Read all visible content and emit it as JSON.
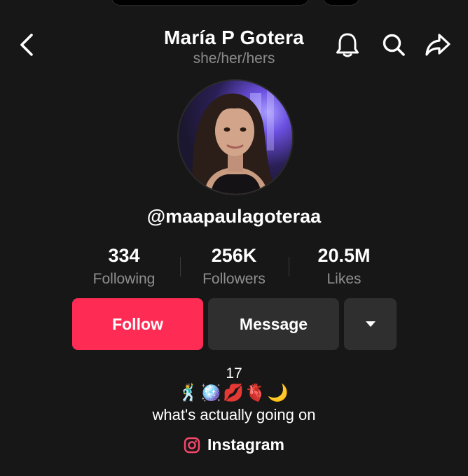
{
  "header": {
    "title": "María P Gotera",
    "pronouns": "she/her/hers",
    "icons": [
      "chevron-left-icon",
      "bell-icon",
      "search-icon",
      "share-icon"
    ]
  },
  "profile": {
    "handle": "@maapaulagoteraa",
    "stats": [
      {
        "value": "334",
        "label": "Following"
      },
      {
        "value": "256K",
        "label": "Followers"
      },
      {
        "value": "20.5M",
        "label": "Likes"
      }
    ]
  },
  "actions": {
    "follow_label": "Follow",
    "message_label": "Message",
    "more_icon": "caret-down-icon"
  },
  "bio": {
    "line1": "17",
    "emojis": "🕺🪩💋🫀🌙",
    "line2": "what's actually going on"
  },
  "link": {
    "label": "Instagram",
    "icon": "instagram-icon"
  },
  "colors": {
    "background": "#171717",
    "accent": "#fe2c55",
    "secondary_button": "#2f2f2f",
    "muted_text": "#8f8f8f"
  }
}
